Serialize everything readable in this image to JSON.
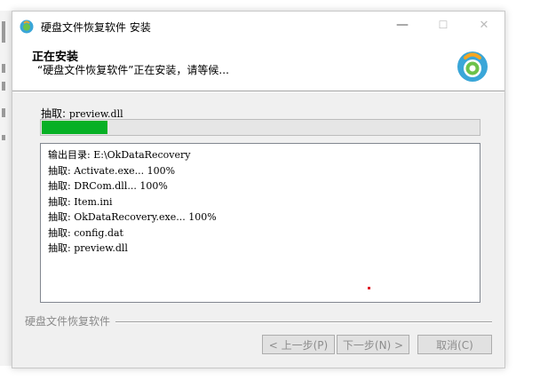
{
  "window": {
    "title": "硬盘文件恢复软件 安装",
    "controls": {
      "minimize": "—",
      "maximize": "☐",
      "close": "✕"
    }
  },
  "header": {
    "title": "正在安装",
    "subtitle": "“硬盘文件恢复软件”正在安装，请等候..."
  },
  "status": {
    "prefix": "抽取:",
    "file": "preview.dll"
  },
  "progress": {
    "fraction": 0.15,
    "color": "#06b025"
  },
  "log": {
    "lines": [
      "输出目录: E:\\OkDataRecovery",
      "抽取: Activate.exe... 100%",
      "抽取: DRCom.dll... 100%",
      "抽取: Item.ini",
      "抽取: OkDataRecovery.exe... 100%",
      "抽取: config.dat",
      "抽取: preview.dll"
    ]
  },
  "footer": {
    "brand": "硬盘文件恢复软件",
    "back_label": "< 上一步(P)",
    "next_label": "下一步(N) >",
    "cancel_label": "取消(C)"
  },
  "colors": {
    "logo_blue": "#3aa6d8",
    "logo_orange": "#f5a623",
    "logo_green": "#6cc24a"
  }
}
